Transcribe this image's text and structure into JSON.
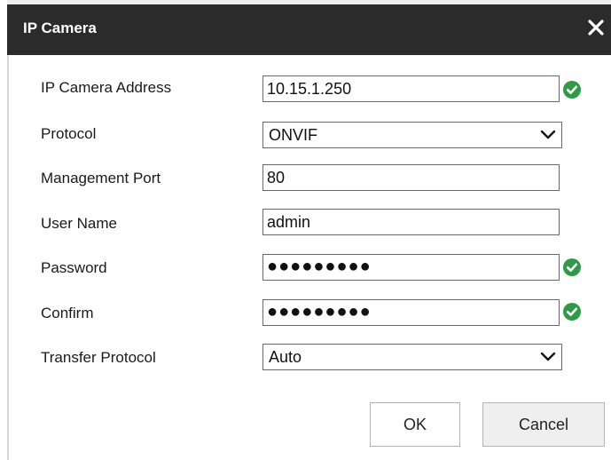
{
  "dialog": {
    "title": "IP Camera",
    "close_icon": "close-icon"
  },
  "form": {
    "ip_address": {
      "label": "IP Camera Address",
      "value": "10.15.1.250",
      "valid": true
    },
    "protocol": {
      "label": "Protocol",
      "value": "ONVIF"
    },
    "management_port": {
      "label": "Management Port",
      "value": "80"
    },
    "user_name": {
      "label": "User Name",
      "value": "admin"
    },
    "password": {
      "label": "Password",
      "value": "●●●●●●●●●",
      "valid": true
    },
    "confirm": {
      "label": "Confirm",
      "value": "●●●●●●●●●",
      "valid": true
    },
    "transfer_protocol": {
      "label": "Transfer Protocol",
      "value": "Auto"
    }
  },
  "buttons": {
    "ok_label": "OK",
    "cancel_label": "Cancel"
  },
  "colors": {
    "titlebar": "#2b2b2b",
    "valid_check": "#2e9b45"
  }
}
